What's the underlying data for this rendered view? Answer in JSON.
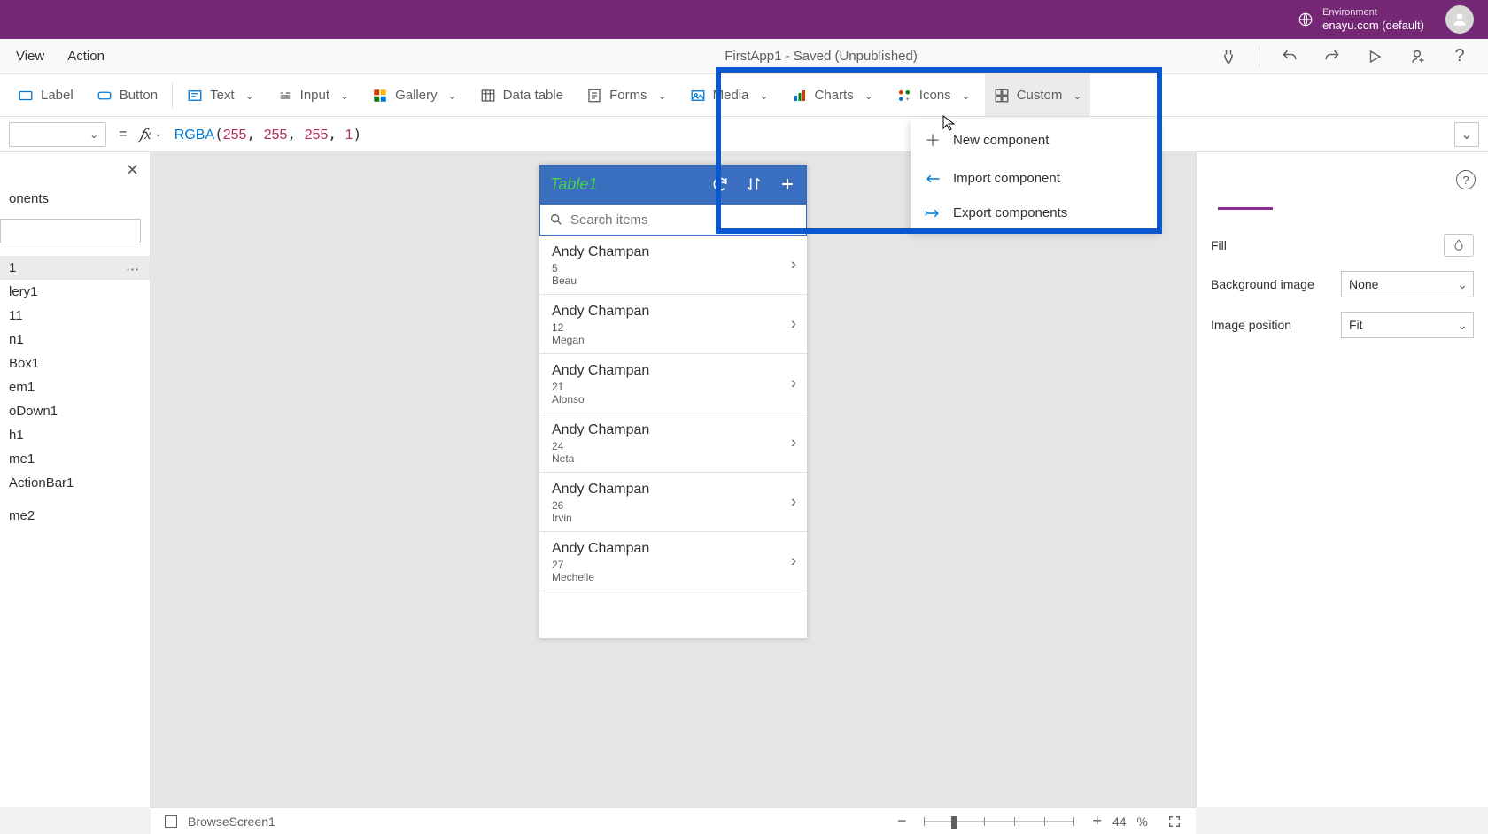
{
  "header": {
    "env_label": "Environment",
    "env_value": "enayu.com (default)"
  },
  "menu": {
    "view": "View",
    "action": "Action",
    "app_status": "FirstApp1 - Saved (Unpublished)"
  },
  "ribbon": {
    "label": "Label",
    "button": "Button",
    "text": "Text",
    "input": "Input",
    "gallery": "Gallery",
    "data_table": "Data table",
    "forms": "Forms",
    "media": "Media",
    "charts": "Charts",
    "icons": "Icons",
    "custom": "Custom"
  },
  "custom_menu": {
    "new_component": "New component",
    "import_component": "Import component",
    "export_components": "Export components"
  },
  "formula": {
    "text": "RGBA(255, 255, 255, 1)"
  },
  "left_panel": {
    "heading": "onents",
    "selected_item": "1",
    "items": [
      "lery1",
      "11",
      "n1",
      "Box1",
      "em1",
      "oDown1",
      "h1",
      "me1",
      "ActionBar1",
      "",
      "me2",
      ""
    ]
  },
  "phone": {
    "title": "Table1",
    "search_placeholder": "Search items",
    "items": [
      {
        "name": "Andy Champan",
        "line2": "5",
        "line3": "Beau"
      },
      {
        "name": "Andy Champan",
        "line2": "12",
        "line3": "Megan"
      },
      {
        "name": "Andy Champan",
        "line2": "21",
        "line3": "Alonso"
      },
      {
        "name": "Andy Champan",
        "line2": "24",
        "line3": "Neta"
      },
      {
        "name": "Andy Champan",
        "line2": "26",
        "line3": "Irvin"
      },
      {
        "name": "Andy Champan",
        "line2": "27",
        "line3": "Mechelle"
      }
    ]
  },
  "props": {
    "fill": "Fill",
    "bg_image": "Background image",
    "bg_image_value": "None",
    "img_pos": "Image position",
    "img_pos_value": "Fit"
  },
  "status": {
    "screen": "BrowseScreen1",
    "zoom": "44",
    "percent": "%"
  }
}
